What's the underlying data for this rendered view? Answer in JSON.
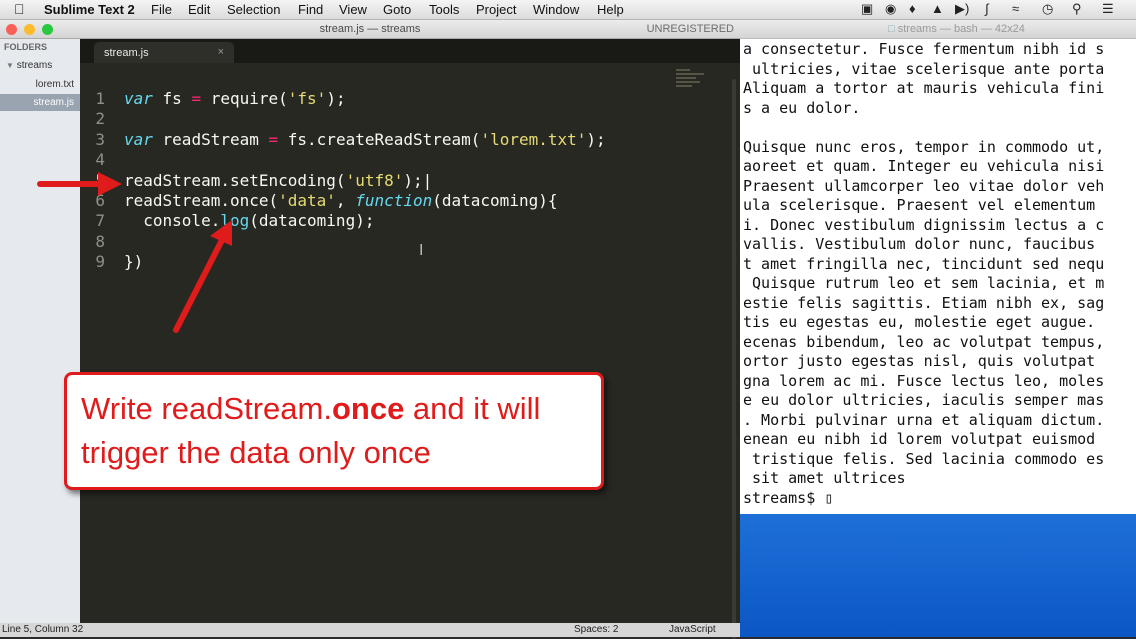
{
  "menubar": {
    "apple_icon": "apple-icon",
    "items": [
      "Sublime Text 2",
      "File",
      "Edit",
      "Selection",
      "Find",
      "View",
      "Goto",
      "Tools",
      "Project",
      "Window",
      "Help"
    ],
    "status_icons": [
      "display-icon",
      "record-icon",
      "bell-icon",
      "drive-icon",
      "volume-icon",
      "bluetooth-icon",
      "wifi-icon",
      "clock-icon",
      "search-icon",
      "list-icon"
    ]
  },
  "sublime": {
    "title": "stream.js — streams",
    "unregistered": "UNREGISTERED",
    "sidebar": {
      "header": "FOLDERS",
      "folder": "streams",
      "files": [
        "lorem.txt",
        "stream.js"
      ],
      "active_file": "stream.js"
    },
    "tab": {
      "label": "stream.js",
      "close": "×"
    },
    "code": {
      "line_numbers": [
        "1",
        "2",
        "3",
        "4",
        "5",
        "6",
        "7",
        "8",
        "9"
      ],
      "lines": [
        [
          {
            "t": "var",
            "c": "kw"
          },
          {
            "t": " fs ",
            "c": ""
          },
          {
            "t": "=",
            "c": "op"
          },
          {
            "t": " require(",
            "c": ""
          },
          {
            "t": "'fs'",
            "c": "str"
          },
          {
            "t": ");",
            "c": ""
          }
        ],
        [],
        [
          {
            "t": "var",
            "c": "kw"
          },
          {
            "t": " readStream ",
            "c": ""
          },
          {
            "t": "=",
            "c": "op"
          },
          {
            "t": " fs.createReadStream(",
            "c": ""
          },
          {
            "t": "'lorem.txt'",
            "c": "str"
          },
          {
            "t": ");",
            "c": ""
          }
        ],
        [],
        [
          {
            "t": "readStream.setEncoding(",
            "c": ""
          },
          {
            "t": "'utf8'",
            "c": "str"
          },
          {
            "t": ");|",
            "c": ""
          }
        ],
        [
          {
            "t": "readStream.once(",
            "c": ""
          },
          {
            "t": "'data'",
            "c": "str"
          },
          {
            "t": ", ",
            "c": ""
          },
          {
            "t": "function",
            "c": "kw"
          },
          {
            "t": "(datacoming){",
            "c": ""
          }
        ],
        [
          {
            "t": "  console.",
            "c": ""
          },
          {
            "t": "log",
            "c": "fn"
          },
          {
            "t": "(datacoming);",
            "c": ""
          }
        ],
        [],
        [
          {
            "t": "})",
            "c": ""
          }
        ]
      ]
    },
    "status": {
      "position": "Line 5, Column 32",
      "spaces": "Spaces: 2",
      "syntax": "JavaScript"
    }
  },
  "terminal": {
    "title": "streams — bash — 42x24",
    "lines": [
      "a consectetur. Fusce fermentum nibh id s",
      " ultricies, vitae scelerisque ante porta",
      "Aliquam a tortor at mauris vehicula fini",
      "s a eu dolor.",
      "",
      "Quisque nunc eros, tempor in commodo ut,",
      "aoreet et quam. Integer eu vehicula nisi",
      "Praesent ullamcorper leo vitae dolor veh",
      "ula scelerisque. Praesent vel elementum",
      "i. Donec vestibulum dignissim lectus a c",
      "vallis. Vestibulum dolor nunc, faucibus",
      "t amet fringilla nec, tincidunt sed nequ",
      " Quisque rutrum leo et sem lacinia, et m",
      "estie felis sagittis. Etiam nibh ex, sag",
      "tis eu egestas eu, molestie eget augue.",
      "ecenas bibendum, leo ac volutpat tempus,",
      "ortor justo egestas nisl, quis volutpat",
      "gna lorem ac mi. Fusce lectus leo, moles",
      "e eu dolor ultricies, iaculis semper mas",
      ". Morbi pulvinar urna et aliquam dictum.",
      "enean eu nibh id lorem volutpat euismod",
      " tristique felis. Sed lacinia commodo es",
      " sit amet ultrices",
      "streams$ ▯"
    ]
  },
  "callout": {
    "line1_prefix": "Write readStream.",
    "line1_bold": "once",
    "line1_suffix": " and it will",
    "line2": "trigger the data only once",
    "color": "#e01b1b"
  },
  "colors": {
    "editor_bg": "#272822",
    "keyword": "#66d9ef",
    "string": "#e6db74",
    "operator": "#f92672",
    "annotation": "#e01b1b"
  }
}
